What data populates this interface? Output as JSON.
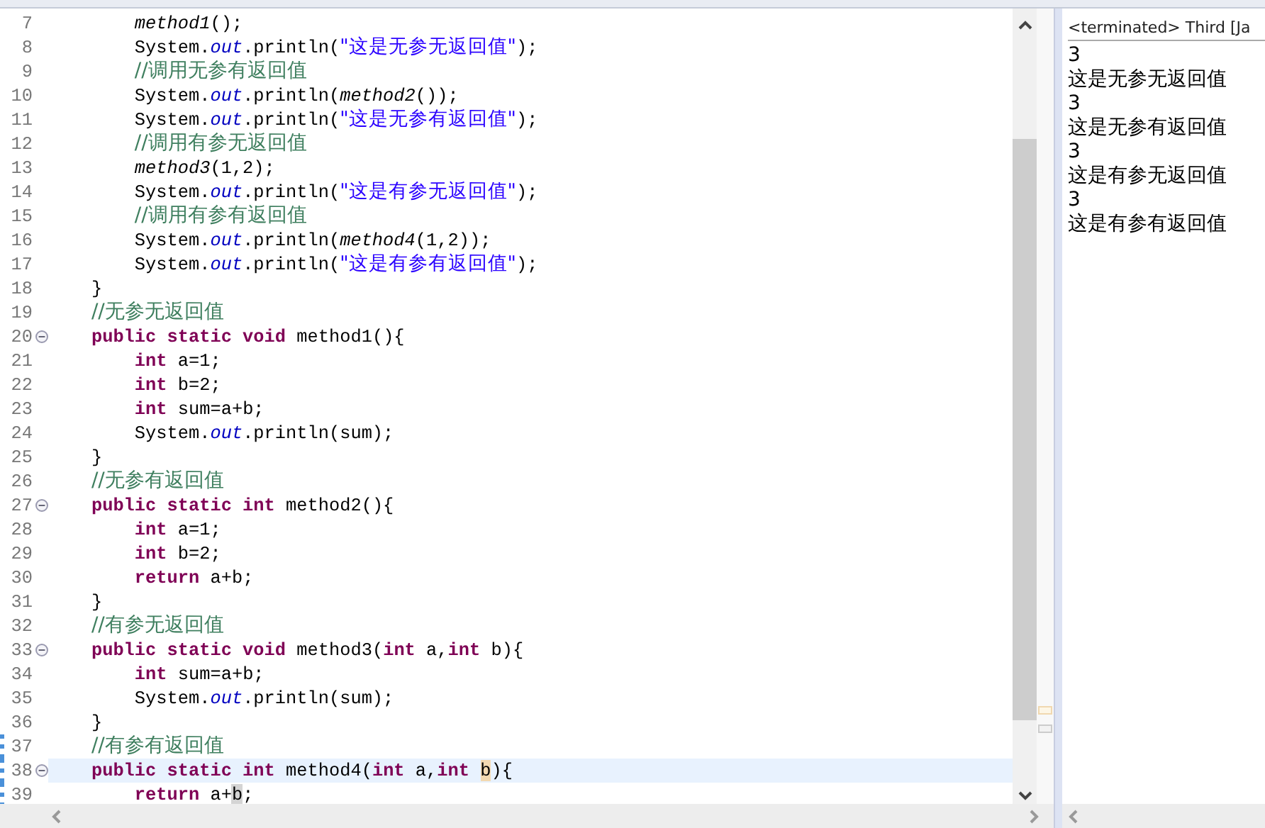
{
  "editor": {
    "lines": [
      {
        "number": "7",
        "foldable": false,
        "current": false,
        "changed": false,
        "tokens": [
          {
            "kind": "static-call",
            "text": "        method1"
          },
          {
            "kind": "plain",
            "text": "();"
          }
        ]
      },
      {
        "number": "8",
        "foldable": false,
        "current": false,
        "changed": false,
        "tokens": [
          {
            "kind": "plain",
            "text": "        System."
          },
          {
            "kind": "field",
            "text": "out"
          },
          {
            "kind": "plain",
            "text": ".println("
          },
          {
            "kind": "string",
            "text": "\"这是无参无返回值\""
          },
          {
            "kind": "plain",
            "text": ");"
          }
        ]
      },
      {
        "number": "9",
        "foldable": false,
        "current": false,
        "changed": false,
        "tokens": [
          {
            "kind": "comment",
            "text": "        //调用无参有返回值"
          }
        ]
      },
      {
        "number": "10",
        "foldable": false,
        "current": false,
        "changed": false,
        "tokens": [
          {
            "kind": "plain",
            "text": "        System."
          },
          {
            "kind": "field",
            "text": "out"
          },
          {
            "kind": "plain",
            "text": ".println("
          },
          {
            "kind": "static-call",
            "text": "method2"
          },
          {
            "kind": "plain",
            "text": "());"
          }
        ]
      },
      {
        "number": "11",
        "foldable": false,
        "current": false,
        "changed": false,
        "tokens": [
          {
            "kind": "plain",
            "text": "        System."
          },
          {
            "kind": "field",
            "text": "out"
          },
          {
            "kind": "plain",
            "text": ".println("
          },
          {
            "kind": "string",
            "text": "\"这是无参有返回值\""
          },
          {
            "kind": "plain",
            "text": ");"
          }
        ]
      },
      {
        "number": "12",
        "foldable": false,
        "current": false,
        "changed": false,
        "tokens": [
          {
            "kind": "comment",
            "text": "        //调用有参无返回值"
          }
        ]
      },
      {
        "number": "13",
        "foldable": false,
        "current": false,
        "changed": false,
        "tokens": [
          {
            "kind": "static-call",
            "text": "        method3"
          },
          {
            "kind": "plain",
            "text": "(1,2);"
          }
        ]
      },
      {
        "number": "14",
        "foldable": false,
        "current": false,
        "changed": false,
        "tokens": [
          {
            "kind": "plain",
            "text": "        System."
          },
          {
            "kind": "field",
            "text": "out"
          },
          {
            "kind": "plain",
            "text": ".println("
          },
          {
            "kind": "string",
            "text": "\"这是有参无返回值\""
          },
          {
            "kind": "plain",
            "text": ");"
          }
        ]
      },
      {
        "number": "15",
        "foldable": false,
        "current": false,
        "changed": false,
        "tokens": [
          {
            "kind": "comment",
            "text": "        //调用有参有返回值"
          }
        ]
      },
      {
        "number": "16",
        "foldable": false,
        "current": false,
        "changed": false,
        "tokens": [
          {
            "kind": "plain",
            "text": "        System."
          },
          {
            "kind": "field",
            "text": "out"
          },
          {
            "kind": "plain",
            "text": ".println("
          },
          {
            "kind": "static-call",
            "text": "method4"
          },
          {
            "kind": "plain",
            "text": "(1,2));"
          }
        ]
      },
      {
        "number": "17",
        "foldable": false,
        "current": false,
        "changed": false,
        "tokens": [
          {
            "kind": "plain",
            "text": "        System."
          },
          {
            "kind": "field",
            "text": "out"
          },
          {
            "kind": "plain",
            "text": ".println("
          },
          {
            "kind": "string",
            "text": "\"这是有参有返回值\""
          },
          {
            "kind": "plain",
            "text": ");"
          }
        ]
      },
      {
        "number": "18",
        "foldable": false,
        "current": false,
        "changed": false,
        "tokens": [
          {
            "kind": "plain",
            "text": "    }"
          }
        ]
      },
      {
        "number": "19",
        "foldable": false,
        "current": false,
        "changed": false,
        "tokens": [
          {
            "kind": "comment",
            "text": "    //无参无返回值"
          }
        ]
      },
      {
        "number": "20",
        "foldable": true,
        "current": false,
        "changed": false,
        "tokens": [
          {
            "kind": "keyword",
            "text": "    public static void"
          },
          {
            "kind": "plain",
            "text": " method1(){"
          }
        ]
      },
      {
        "number": "21",
        "foldable": false,
        "current": false,
        "changed": false,
        "tokens": [
          {
            "kind": "keyword",
            "text": "        int"
          },
          {
            "kind": "plain",
            "text": " a=1;"
          }
        ]
      },
      {
        "number": "22",
        "foldable": false,
        "current": false,
        "changed": false,
        "tokens": [
          {
            "kind": "keyword",
            "text": "        int"
          },
          {
            "kind": "plain",
            "text": " b=2;"
          }
        ]
      },
      {
        "number": "23",
        "foldable": false,
        "current": false,
        "changed": false,
        "tokens": [
          {
            "kind": "keyword",
            "text": "        int"
          },
          {
            "kind": "plain",
            "text": " sum=a+b;"
          }
        ]
      },
      {
        "number": "24",
        "foldable": false,
        "current": false,
        "changed": false,
        "tokens": [
          {
            "kind": "plain",
            "text": "        System."
          },
          {
            "kind": "field",
            "text": "out"
          },
          {
            "kind": "plain",
            "text": ".println(sum);"
          }
        ]
      },
      {
        "number": "25",
        "foldable": false,
        "current": false,
        "changed": false,
        "tokens": [
          {
            "kind": "plain",
            "text": "    }"
          }
        ]
      },
      {
        "number": "26",
        "foldable": false,
        "current": false,
        "changed": false,
        "tokens": [
          {
            "kind": "comment",
            "text": "    //无参有返回值"
          }
        ]
      },
      {
        "number": "27",
        "foldable": true,
        "current": false,
        "changed": false,
        "tokens": [
          {
            "kind": "keyword",
            "text": "    public static int"
          },
          {
            "kind": "plain",
            "text": " method2(){"
          }
        ]
      },
      {
        "number": "28",
        "foldable": false,
        "current": false,
        "changed": false,
        "tokens": [
          {
            "kind": "keyword",
            "text": "        int"
          },
          {
            "kind": "plain",
            "text": " a=1;"
          }
        ]
      },
      {
        "number": "29",
        "foldable": false,
        "current": false,
        "changed": false,
        "tokens": [
          {
            "kind": "keyword",
            "text": "        int"
          },
          {
            "kind": "plain",
            "text": " b=2;"
          }
        ]
      },
      {
        "number": "30",
        "foldable": false,
        "current": false,
        "changed": false,
        "tokens": [
          {
            "kind": "keyword",
            "text": "        return"
          },
          {
            "kind": "plain",
            "text": " a+b;"
          }
        ]
      },
      {
        "number": "31",
        "foldable": false,
        "current": false,
        "changed": false,
        "tokens": [
          {
            "kind": "plain",
            "text": "    }"
          }
        ]
      },
      {
        "number": "32",
        "foldable": false,
        "current": false,
        "changed": false,
        "tokens": [
          {
            "kind": "comment",
            "text": "    //有参无返回值"
          }
        ]
      },
      {
        "number": "33",
        "foldable": true,
        "current": false,
        "changed": false,
        "tokens": [
          {
            "kind": "keyword",
            "text": "    public static void"
          },
          {
            "kind": "plain",
            "text": " method3("
          },
          {
            "kind": "keyword",
            "text": "int"
          },
          {
            "kind": "plain",
            "text": " a,"
          },
          {
            "kind": "keyword",
            "text": "int"
          },
          {
            "kind": "plain",
            "text": " b){"
          }
        ]
      },
      {
        "number": "34",
        "foldable": false,
        "current": false,
        "changed": false,
        "tokens": [
          {
            "kind": "keyword",
            "text": "        int"
          },
          {
            "kind": "plain",
            "text": " sum=a+b;"
          }
        ]
      },
      {
        "number": "35",
        "foldable": false,
        "current": false,
        "changed": false,
        "tokens": [
          {
            "kind": "plain",
            "text": "        System."
          },
          {
            "kind": "field",
            "text": "out"
          },
          {
            "kind": "plain",
            "text": ".println(sum);"
          }
        ]
      },
      {
        "number": "36",
        "foldable": false,
        "current": false,
        "changed": false,
        "tokens": [
          {
            "kind": "plain",
            "text": "    }"
          }
        ]
      },
      {
        "number": "37",
        "foldable": false,
        "current": false,
        "changed": true,
        "tokens": [
          {
            "kind": "comment",
            "text": "    //有参有返回值"
          }
        ]
      },
      {
        "number": "38",
        "foldable": true,
        "current": true,
        "changed": true,
        "tokens": [
          {
            "kind": "keyword",
            "text": "    public static int"
          },
          {
            "kind": "plain",
            "text": " method4("
          },
          {
            "kind": "keyword",
            "text": "int"
          },
          {
            "kind": "plain",
            "text": " a,"
          },
          {
            "kind": "keyword",
            "text": "int"
          },
          {
            "kind": "occurrence",
            "text": " b"
          },
          {
            "kind": "plain",
            "text": "){"
          }
        ]
      },
      {
        "number": "39",
        "foldable": false,
        "current": false,
        "changed": true,
        "tokens": [
          {
            "kind": "keyword",
            "text": "        return"
          },
          {
            "kind": "plain",
            "text": " a+"
          },
          {
            "kind": "caret-mark",
            "text": "b"
          },
          {
            "kind": "plain",
            "text": ";"
          }
        ]
      }
    ]
  },
  "console": {
    "header": "<terminated> Third [Ja",
    "output": [
      "3",
      "这是无参无返回值",
      "3",
      "这是无参有返回值",
      "3",
      "这是有参无返回值",
      "3",
      "这是有参有返回值"
    ]
  }
}
